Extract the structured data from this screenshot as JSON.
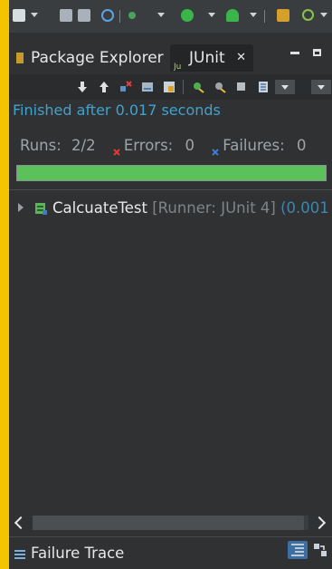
{
  "toolbar": {
    "icons": [
      "new-icon",
      "save-icon",
      "save-all-icon",
      "search-icon",
      "debug-icon",
      "run-icon",
      "external-tools-icon",
      "grid-icon",
      "refresh-icon"
    ]
  },
  "tabs": {
    "package_explorer": "Package Explorer",
    "junit": "JUnit",
    "close_glyph": "✕"
  },
  "junit": {
    "status": "Finished after 0.017 seconds",
    "runs_label": "Runs:",
    "runs_value": "2/2",
    "errors_label": "Errors:",
    "errors_value": "0",
    "failures_label": "Failures:",
    "failures_value": "0",
    "progress_fraction": 1.0,
    "bar_color": "#5bc15b"
  },
  "tree": {
    "items": [
      {
        "name": "CalcuateTest",
        "runner": "[Runner: JUnit 4]",
        "time": "(0.001"
      }
    ]
  },
  "footer": {
    "failure_trace": "Failure Trace"
  },
  "colors": {
    "accent": "#3fa3cf",
    "background": "#2f3133",
    "border": "#f4c400"
  }
}
